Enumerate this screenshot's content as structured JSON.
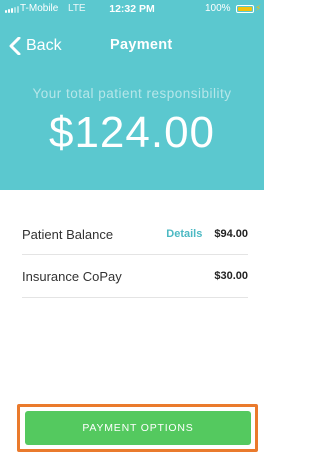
{
  "status_bar": {
    "carrier": "T-Mobile",
    "network": "LTE",
    "time": "12:32 PM",
    "battery_percent": "100%",
    "battery_level": 1.0
  },
  "nav": {
    "back_label": "Back",
    "title": "Payment"
  },
  "summary": {
    "label": "Your total patient responsibility",
    "amount": "$124.00"
  },
  "rows": [
    {
      "label": "Patient Balance",
      "link": "Details",
      "value": "$94.00"
    },
    {
      "label": "Insurance CoPay",
      "value": "$30.00"
    }
  ],
  "footer": {
    "button_label": "PAYMENT OPTIONS"
  },
  "colors": {
    "header_bg": "#5bc8cf",
    "accent": "#4cb9c3",
    "button_bg": "#54c95f",
    "highlight_border": "#ea7a2c",
    "battery": "#f4c20d"
  }
}
